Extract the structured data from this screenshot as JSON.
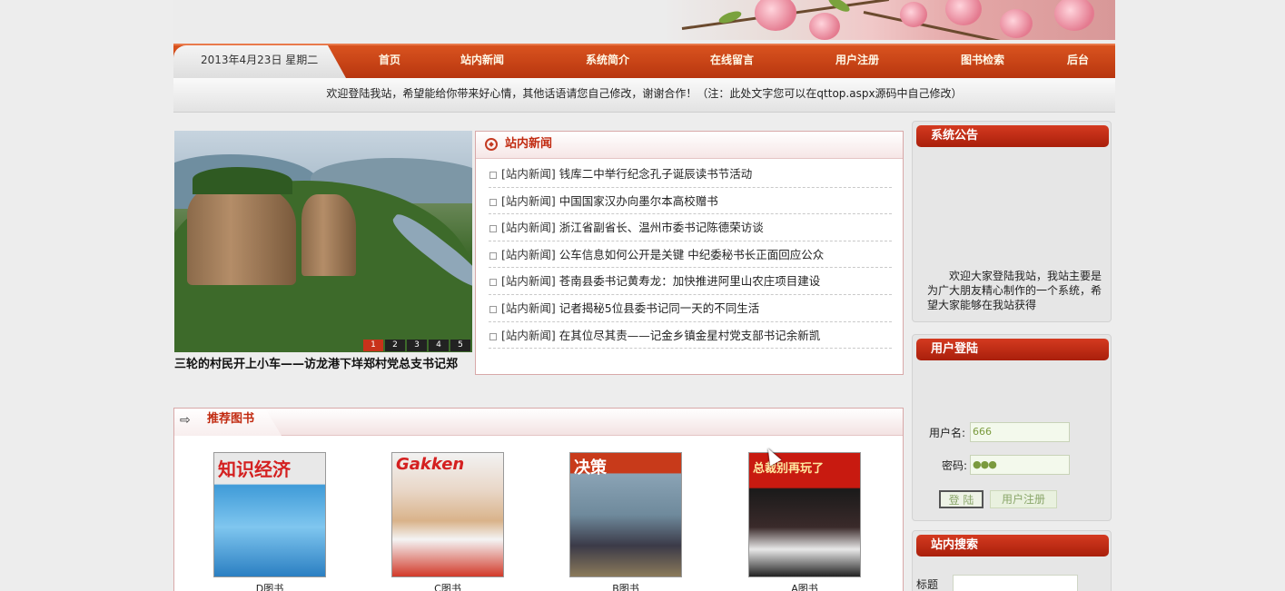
{
  "header": {
    "date": "2013年4月23日  星期二",
    "nav": [
      "首页",
      "站内新闻",
      "系统简介",
      "在线留言",
      "用户注册",
      "图书检索",
      "后台"
    ],
    "welcome": "欢迎登陆我站，希望能给你带来好心情，其他话语请您自己修改，谢谢合作！（注：此处文字您可以在qttop.aspx源码中自己修改）"
  },
  "slideshow": {
    "caption": "三轮的村民开上小车——访龙港下垟郑村党总支书记郑",
    "pages": [
      "1",
      "2",
      "3",
      "4",
      "5"
    ],
    "active_page": "1"
  },
  "news": {
    "title": "站内新闻",
    "items": [
      {
        "category": "[站内新闻]",
        "title": "钱库二中举行纪念孔子诞辰读书节活动"
      },
      {
        "category": "[站内新闻]",
        "title": "中国国家汉办向墨尔本高校赠书"
      },
      {
        "category": "[站内新闻]",
        "title": "浙江省副省长、温州市委书记陈德荣访谈"
      },
      {
        "category": "[站内新闻]",
        "title": "公车信息如何公开是关键 中纪委秘书长正面回应公众"
      },
      {
        "category": "[站内新闻]",
        "title": "苍南县委书记黄寿龙：加快推进阿里山农庄项目建设"
      },
      {
        "category": "[站内新闻]",
        "title": "记者揭秘5位县委书记同一天的不同生活"
      },
      {
        "category": "[站内新闻]",
        "title": "在其位尽其责——记金乡镇金星村党支部书记余新凯"
      }
    ]
  },
  "books": {
    "title": "推荐图书",
    "items": [
      {
        "name": "D图书",
        "cover_text": "知识经济"
      },
      {
        "name": "C图书",
        "cover_text": "Gakken"
      },
      {
        "name": "B图书",
        "cover_text": "决策"
      },
      {
        "name": "A图书",
        "cover_text": "总裁别再玩了"
      }
    ]
  },
  "notice": {
    "title": "系统公告",
    "text": "欢迎大家登陆我站，我站主要是为广大朋友精心制作的一个系统，希望大家能够在我站获得"
  },
  "login": {
    "title": "用户登陆",
    "username_label": "用户名:",
    "username_value": "666",
    "password_label": "密码:",
    "password_value": "●●●",
    "login_button": "登 陆",
    "register_button": "用户注册"
  },
  "search": {
    "title": "站内搜索",
    "label": "标题"
  }
}
